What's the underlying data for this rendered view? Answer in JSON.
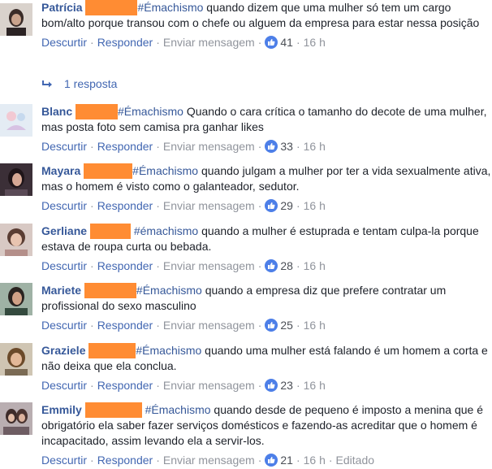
{
  "actions": {
    "unlike": "Descurtir",
    "reply": "Responder",
    "message": "Enviar mensagem",
    "sep": "·"
  },
  "reply_link": "1 resposta",
  "comments": [
    {
      "author": "Patrícia",
      "tag": "#Émachismo",
      "text": " quando dizem que uma mulher só tem um cargo bom/alto porque transou com o chefe ou alguem da empresa para estar nessa posição",
      "likes": "41",
      "time": "16 h",
      "edited": ""
    },
    {
      "author": "Blanc",
      "tag": "#Émachismo",
      "text": " Quando o cara crítica o tamanho do decote de uma mulher, mas posta foto sem camisa pra ganhar likes",
      "likes": "33",
      "time": "16 h",
      "edited": ""
    },
    {
      "author": "Mayara",
      "tag": "#Émachismo",
      "text": " quando julgam a mulher por ter a vida sexualmente ativa, mas o homem é visto como o galanteador, sedutor.",
      "likes": "29",
      "time": "16 h",
      "edited": ""
    },
    {
      "author": "Gerliane",
      "tag": "#émachismo",
      "text": " quando a mulher é estuprada e tentam culpa-la porque estava de roupa curta ou bebada.",
      "likes": "28",
      "time": "16 h",
      "edited": ""
    },
    {
      "author": "Mariete",
      "tag": "#Émachismo",
      "text": " quando a empresa diz que prefere contratar um profissional do sexo masculino",
      "likes": "25",
      "time": "16 h",
      "edited": ""
    },
    {
      "author": "Graziele",
      "tag": "#Émachismo",
      "text": " quando uma mulher está falando é um homem a corta e não deixa que ela conclua.",
      "likes": "23",
      "time": "16 h",
      "edited": ""
    },
    {
      "author": "Emmily",
      "tag": "#Émachismo",
      "text": " quando desde de pequeno é imposto a menina que é obrigatório ela saber fazer serviços domésticos e fazendo-as acreditar que o homem é incapacitado, assim levando ela a servir-los.",
      "likes": "21",
      "time": "16 h",
      "edited": "Editado"
    }
  ]
}
